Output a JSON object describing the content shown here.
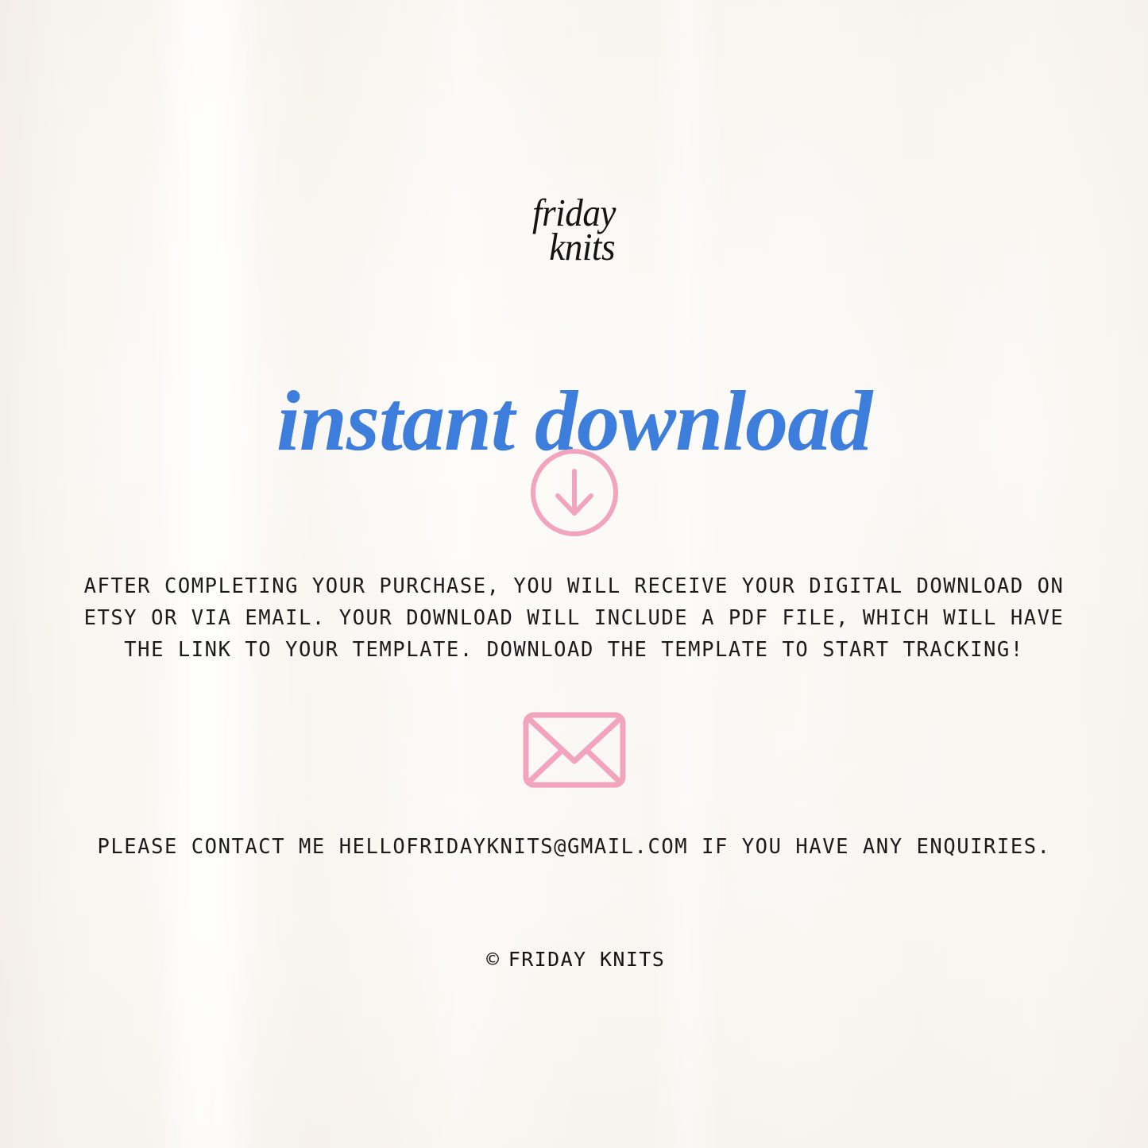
{
  "brand": {
    "logo_line_1": "friday",
    "logo_line_2": "knits"
  },
  "headline": {
    "text": "instant download",
    "color": "#3d7ddb"
  },
  "icons": {
    "download": "download-arrow-circle-icon",
    "envelope": "envelope-icon",
    "accent_color": "#f2a4be"
  },
  "body": {
    "paragraph": "AFTER COMPLETING YOUR PURCHASE, YOU WILL RECEIVE YOUR DIGITAL DOWNLOAD ON ETSY OR VIA EMAIL. YOUR DOWNLOAD WILL INCLUDE A PDF FILE, WHICH WILL HAVE THE LINK TO YOUR TEMPLATE. DOWNLOAD THE TEMPLATE TO START TRACKING!"
  },
  "contact": {
    "text": "PLEASE CONTACT ME HELLOFRIDAYKNITS@GMAIL.COM IF YOU HAVE ANY ENQUIRIES.",
    "email": "HELLOFRIDAYKNITS@GMAIL.COM"
  },
  "footer": {
    "mark": "©",
    "text": "FRIDAY KNITS"
  },
  "theme": {
    "background": "#faf7f3",
    "text": "#1b1b1b",
    "pink": "#f2a4be",
    "blue": "#3d7ddb"
  }
}
